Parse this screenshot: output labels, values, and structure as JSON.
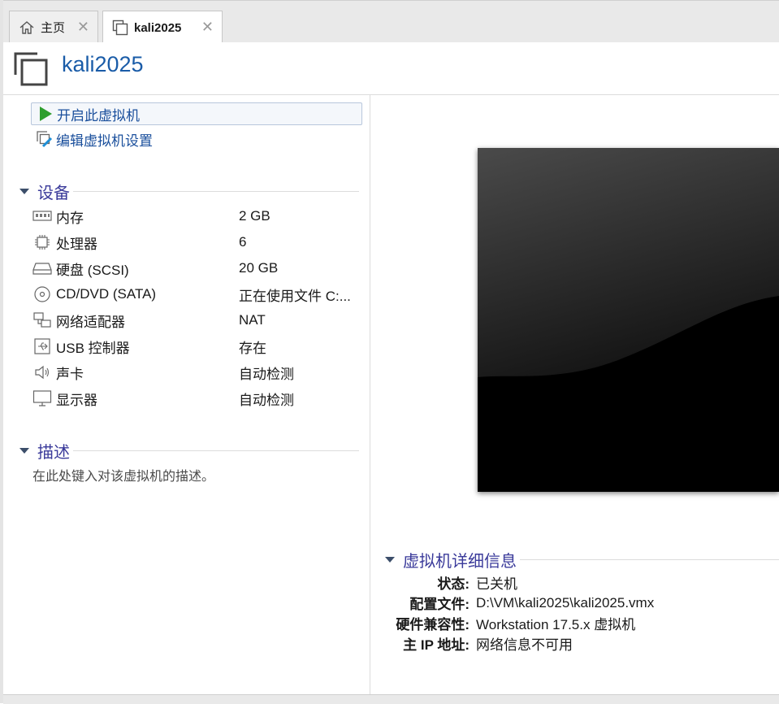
{
  "tabs": [
    {
      "label": "主页",
      "icon": "home-icon",
      "active": false
    },
    {
      "label": "kali2025",
      "icon": "vm-icon",
      "active": true
    }
  ],
  "header": {
    "title": "kali2025",
    "icon": "vm-icon"
  },
  "actions": {
    "power_on": "开启此虚拟机",
    "edit_settings": "编辑虚拟机设置"
  },
  "devices": {
    "section_title": "设备",
    "items": [
      {
        "icon": "memory-icon",
        "name": "内存",
        "value": "2 GB"
      },
      {
        "icon": "cpu-icon",
        "name": "处理器",
        "value": "6"
      },
      {
        "icon": "harddisk-icon",
        "name": "硬盘 (SCSI)",
        "value": "20 GB"
      },
      {
        "icon": "cd-dvd-icon",
        "name": "CD/DVD (SATA)",
        "value": "正在使用文件 C:..."
      },
      {
        "icon": "network-adapter-icon",
        "name": "网络适配器",
        "value": "NAT"
      },
      {
        "icon": "usb-icon",
        "name": "USB 控制器",
        "value": "存在"
      },
      {
        "icon": "sound-icon",
        "name": "声卡",
        "value": "自动检测"
      },
      {
        "icon": "display-icon",
        "name": "显示器",
        "value": "自动检测"
      }
    ]
  },
  "description": {
    "section_title": "描述",
    "placeholder": "在此处键入对该虚拟机的描述。"
  },
  "details": {
    "section_title": "虚拟机详细信息",
    "rows": [
      {
        "key": "状态:",
        "value": "已关机"
      },
      {
        "key": "配置文件:",
        "value": "D:\\VM\\kali2025\\kali2025.vmx"
      },
      {
        "key": "硬件兼容性:",
        "value": "Workstation 17.5.x 虚拟机"
      },
      {
        "key": "主 IP 地址:",
        "value": "网络信息不可用"
      }
    ]
  },
  "colors": {
    "accent": "#1a5ca8",
    "section_title": "#3a3a9a",
    "play_green": "#2e9e2e"
  }
}
